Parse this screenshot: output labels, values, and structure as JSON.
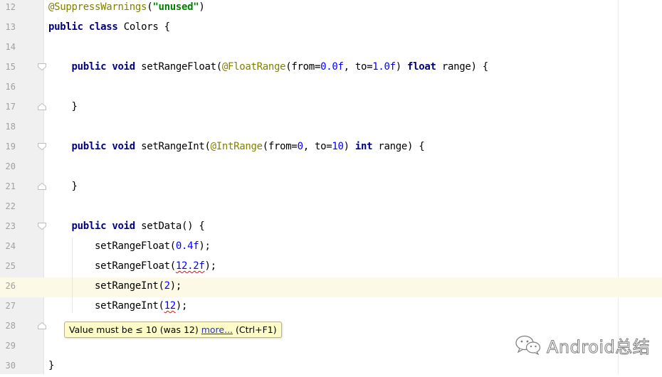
{
  "editor": {
    "lines": [
      {
        "num": "12",
        "segments": [
          {
            "t": "@SuppressWarnings",
            "c": "ann"
          },
          {
            "t": "(",
            "c": ""
          },
          {
            "t": "\"unused\"",
            "c": "str"
          },
          {
            "t": ")",
            "c": ""
          }
        ]
      },
      {
        "num": "13",
        "segments": [
          {
            "t": "public class ",
            "c": "kw"
          },
          {
            "t": "Colors {",
            "c": ""
          }
        ]
      },
      {
        "num": "14",
        "segments": []
      },
      {
        "num": "15",
        "segments": [
          {
            "t": "    public void ",
            "c": "kw"
          },
          {
            "t": "setRangeFloat(",
            "c": ""
          },
          {
            "t": "@FloatRange",
            "c": "ann"
          },
          {
            "t": "(from=",
            "c": ""
          },
          {
            "t": "0.0f",
            "c": "num"
          },
          {
            "t": ", to=",
            "c": ""
          },
          {
            "t": "1.0f",
            "c": "num"
          },
          {
            "t": ") ",
            "c": ""
          },
          {
            "t": "float ",
            "c": "kw"
          },
          {
            "t": "range) {",
            "c": ""
          }
        ]
      },
      {
        "num": "16",
        "segments": []
      },
      {
        "num": "17",
        "segments": [
          {
            "t": "    }",
            "c": ""
          }
        ]
      },
      {
        "num": "18",
        "segments": []
      },
      {
        "num": "19",
        "segments": [
          {
            "t": "    public void ",
            "c": "kw"
          },
          {
            "t": "setRangeInt(",
            "c": ""
          },
          {
            "t": "@IntRange",
            "c": "ann"
          },
          {
            "t": "(from=",
            "c": ""
          },
          {
            "t": "0",
            "c": "num"
          },
          {
            "t": ", to=",
            "c": ""
          },
          {
            "t": "10",
            "c": "num"
          },
          {
            "t": ") ",
            "c": ""
          },
          {
            "t": "int ",
            "c": "kw"
          },
          {
            "t": "range) {",
            "c": ""
          }
        ]
      },
      {
        "num": "20",
        "segments": []
      },
      {
        "num": "21",
        "segments": [
          {
            "t": "    }",
            "c": ""
          }
        ]
      },
      {
        "num": "22",
        "segments": []
      },
      {
        "num": "23",
        "segments": [
          {
            "t": "    public void ",
            "c": "kw"
          },
          {
            "t": "setData() {",
            "c": ""
          }
        ]
      },
      {
        "num": "24",
        "segments": [
          {
            "t": "        setRangeFloat(",
            "c": ""
          },
          {
            "t": "0.4f",
            "c": "num"
          },
          {
            "t": ");",
            "c": ""
          }
        ]
      },
      {
        "num": "25",
        "segments": [
          {
            "t": "        setRangeFloat(",
            "c": ""
          },
          {
            "t": "12.2f",
            "c": "num err"
          },
          {
            "t": ");",
            "c": ""
          }
        ]
      },
      {
        "num": "26",
        "segments": [
          {
            "t": "        setRangeInt(",
            "c": ""
          },
          {
            "t": "2",
            "c": "num"
          },
          {
            "t": ");",
            "c": ""
          }
        ]
      },
      {
        "num": "27",
        "segments": [
          {
            "t": "        setRangeInt(",
            "c": ""
          },
          {
            "t": "12",
            "c": "num err"
          },
          {
            "t": ");",
            "c": ""
          }
        ]
      },
      {
        "num": "28",
        "segments": []
      },
      {
        "num": "29",
        "segments": []
      },
      {
        "num": "30",
        "segments": [
          {
            "t": "}",
            "c": ""
          }
        ]
      }
    ],
    "current_line": "26"
  },
  "tooltip": {
    "message": "Value must be ≤ 10 (was 12) ",
    "link": "more...",
    "shortcut": " (Ctrl+F1)"
  },
  "watermark": {
    "text": "Android总结",
    "icon": "wechat-icon"
  }
}
